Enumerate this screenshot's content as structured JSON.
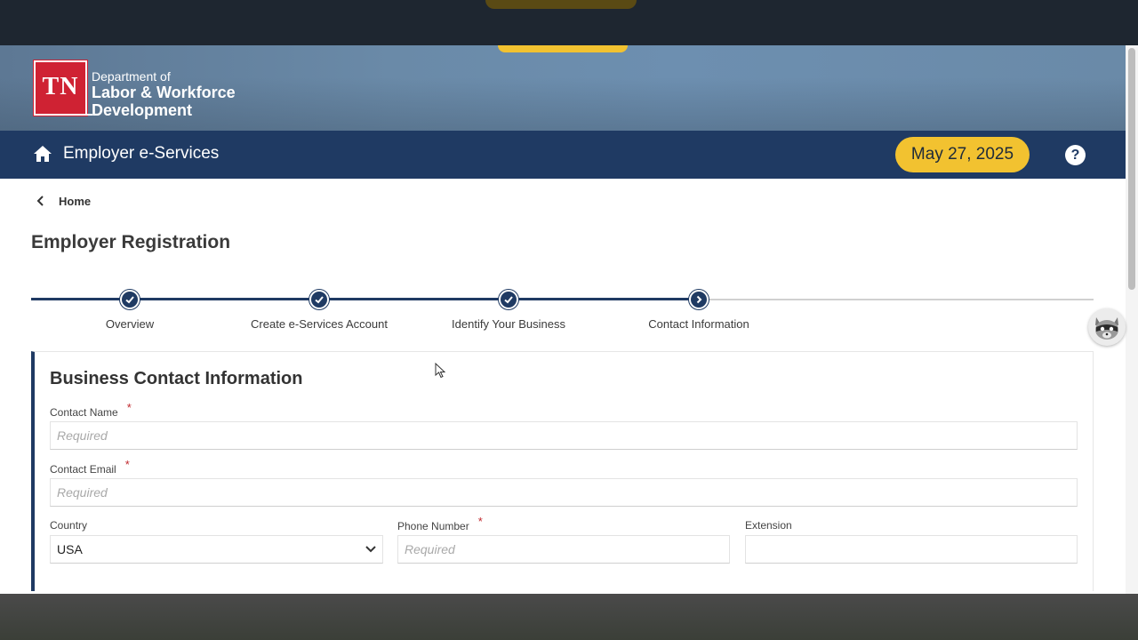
{
  "header": {
    "logo_text": "TN",
    "dept_line1": "Department of",
    "dept_line2": "Labor & Workforce",
    "dept_line3": "Development"
  },
  "navbar": {
    "app_title": "Employer e-Services",
    "date": "May 27, 2025",
    "help_label": "?"
  },
  "breadcrumb": {
    "home_label": "Home"
  },
  "page_title": "Employer Registration",
  "stepper": {
    "steps": [
      {
        "label": "Overview",
        "state": "complete"
      },
      {
        "label": "Create e-Services Account",
        "state": "complete"
      },
      {
        "label": "Identify Your Business",
        "state": "complete"
      },
      {
        "label": "Contact Information",
        "state": "current"
      }
    ]
  },
  "form": {
    "title": "Business Contact Information",
    "contact_name": {
      "label": "Contact Name",
      "required_mark": "*",
      "placeholder": "Required",
      "value": ""
    },
    "contact_email": {
      "label": "Contact Email",
      "required_mark": "*",
      "placeholder": "Required",
      "value": ""
    },
    "country": {
      "label": "Country",
      "value": "USA"
    },
    "phone": {
      "label": "Phone Number",
      "required_mark": "*",
      "placeholder": "Required",
      "value": ""
    },
    "extension": {
      "label": "Extension",
      "placeholder": "",
      "value": ""
    }
  },
  "colors": {
    "navy": "#1f3a63",
    "accent_yellow": "#f2c230",
    "brand_red": "#cf2233",
    "required_red": "#c0282d"
  }
}
